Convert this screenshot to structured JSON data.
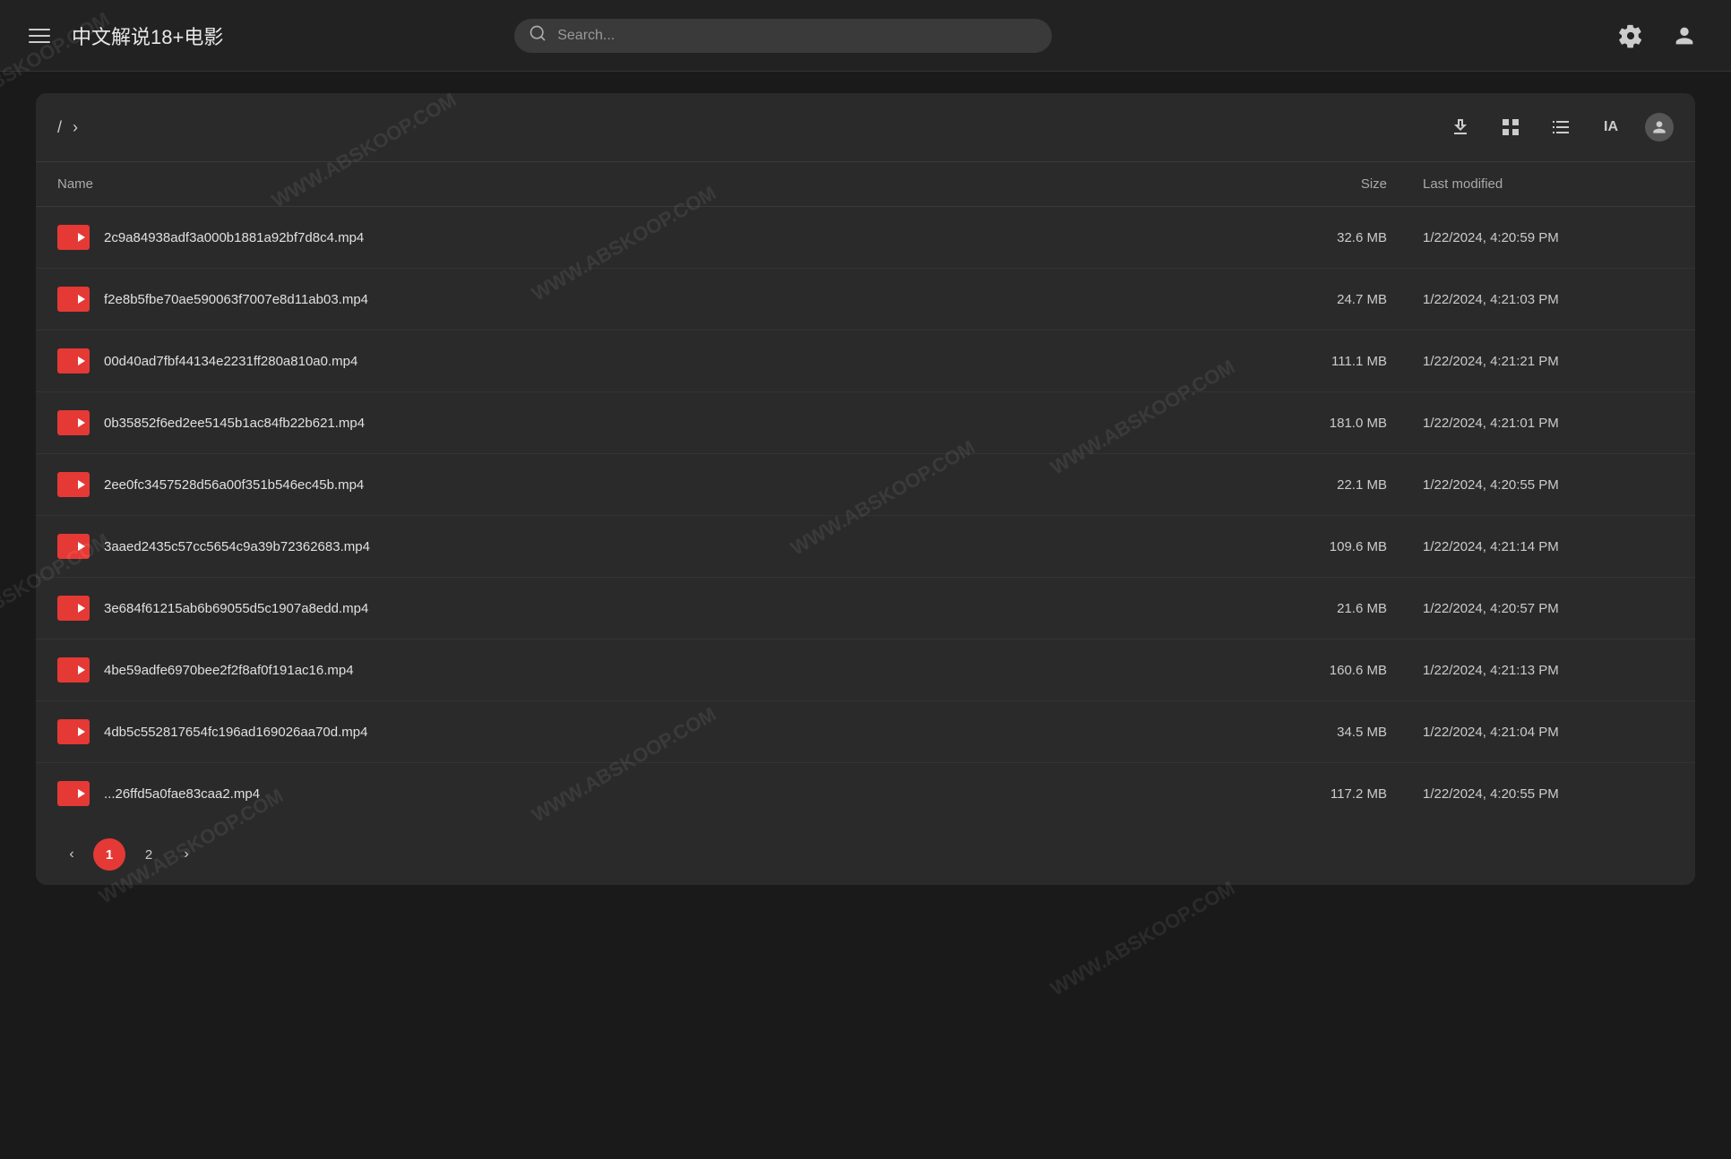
{
  "topbar": {
    "title": "中文解说18+电影",
    "search_placeholder": "Search..."
  },
  "breadcrumb": {
    "slash": "/",
    "arrow": "›"
  },
  "table": {
    "headers": {
      "name": "Name",
      "size": "Size",
      "modified": "Last modified"
    },
    "files": [
      {
        "name": "2c9a84938adf3a000b1881a92bf7d8c4.mp4",
        "size": "32.6 MB",
        "modified": "1/22/2024, 4:20:59 PM"
      },
      {
        "name": "f2e8b5fbe70ae590063f7007e8d11ab03.mp4",
        "size": "24.7 MB",
        "modified": "1/22/2024, 4:21:03 PM"
      },
      {
        "name": "00d40ad7fbf44134e2231ff280a810a0.mp4",
        "size": "111.1 MB",
        "modified": "1/22/2024, 4:21:21 PM"
      },
      {
        "name": "0b35852f6ed2ee5145b1ac84fb22b621.mp4",
        "size": "181.0 MB",
        "modified": "1/22/2024, 4:21:01 PM"
      },
      {
        "name": "2ee0fc3457528d56a00f351b546ec45b.mp4",
        "size": "22.1 MB",
        "modified": "1/22/2024, 4:20:55 PM"
      },
      {
        "name": "3aaed2435c57cc5654c9a39b72362683.mp4",
        "size": "109.6 MB",
        "modified": "1/22/2024, 4:21:14 PM"
      },
      {
        "name": "3e684f61215ab6b69055d5c1907a8edd.mp4",
        "size": "21.6 MB",
        "modified": "1/22/2024, 4:20:57 PM"
      },
      {
        "name": "4be59adfe6970bee2f2f8af0f191ac16.mp4",
        "size": "160.6 MB",
        "modified": "1/22/2024, 4:21:13 PM"
      },
      {
        "name": "4db5c552817654fc196ad169026aa70d.mp4",
        "size": "34.5 MB",
        "modified": "1/22/2024, 4:21:04 PM"
      },
      {
        "name": "...26ffd5a0fae83caa2.mp4",
        "size": "117.2 MB",
        "modified": "1/22/2024, 4:20:55 PM"
      }
    ]
  },
  "pagination": {
    "prev_label": "‹",
    "next_label": "›",
    "pages": [
      "1",
      "2"
    ],
    "active_page": "1"
  }
}
